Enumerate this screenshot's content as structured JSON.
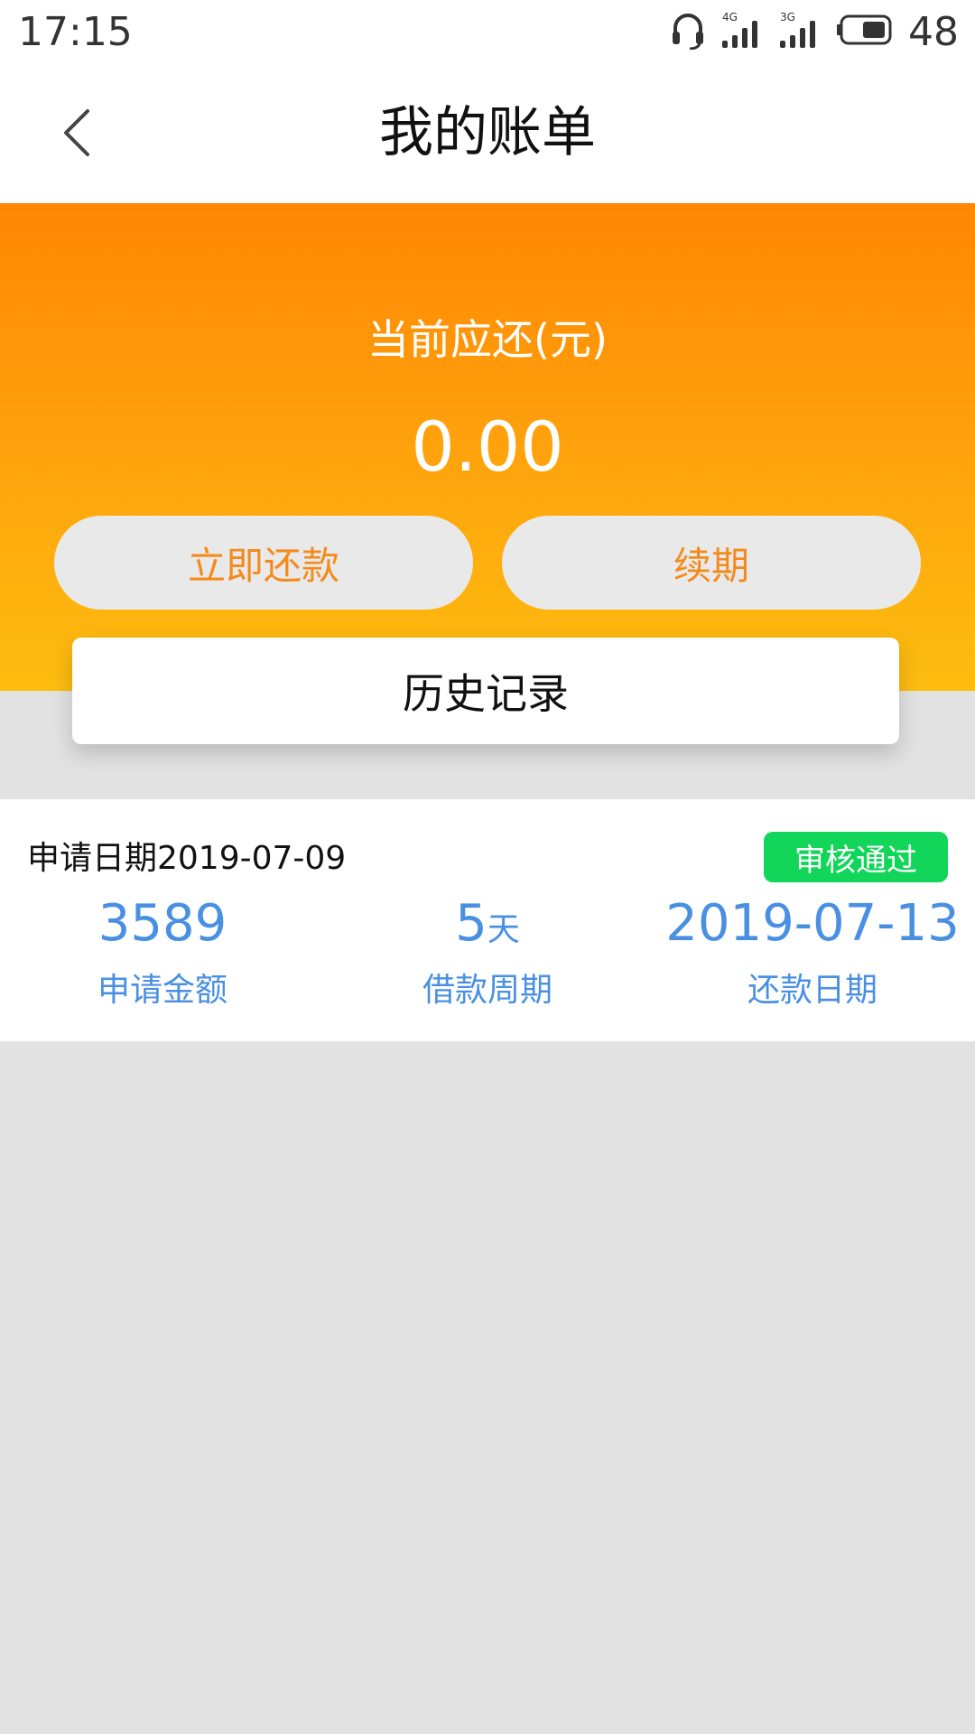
{
  "status_bar": {
    "time": "17:15",
    "battery": "48",
    "icons": [
      "headset-icon",
      "signal-4g-icon",
      "signal-3g-icon",
      "battery-icon"
    ]
  },
  "header": {
    "title": "我的账单",
    "back_icon": "chevron-left-icon"
  },
  "hero": {
    "label": "当前应还(元)",
    "amount": "0.00",
    "repay_button": "立即还款",
    "renew_button": "续期",
    "history_button": "历史记录"
  },
  "record": {
    "date_text": "申请日期2019-07-09",
    "status": "审核通过",
    "stats": [
      {
        "value": "3589",
        "unit": "",
        "label": "申请金额"
      },
      {
        "value": "5",
        "unit": "天",
        "label": "借款周期"
      },
      {
        "value": "2019-07-13",
        "unit": "",
        "label": "还款日期"
      }
    ]
  },
  "colors": {
    "accent_orange": "#ff8603",
    "button_text": "#f38b1c",
    "stat_blue": "#4a90e2",
    "badge_green": "#11d659",
    "background": "#e2e2e2"
  }
}
